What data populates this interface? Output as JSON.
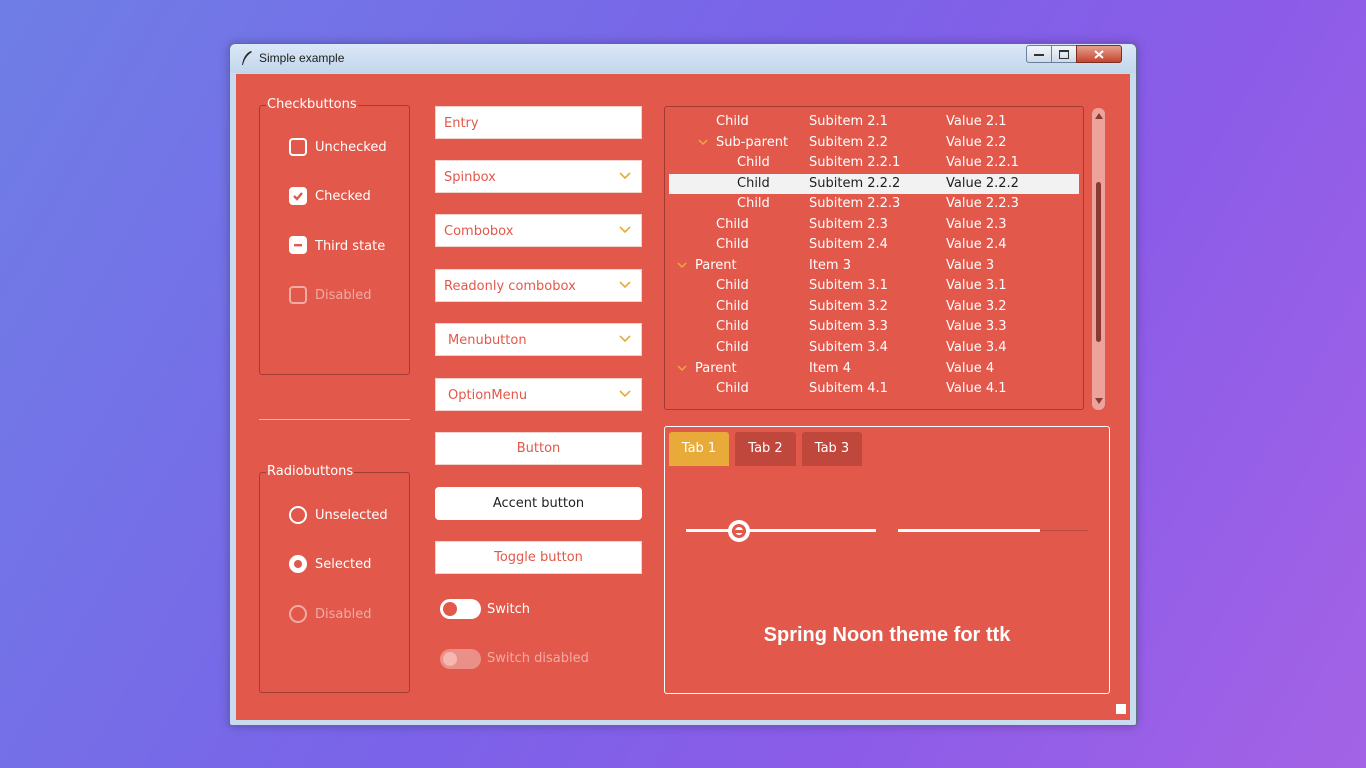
{
  "window": {
    "title": "Simple example",
    "accent_color": "#e2584b",
    "highlight_color": "#e8ab39"
  },
  "checkbuttons": {
    "label": "Checkbuttons",
    "items": [
      {
        "label": "Unchecked",
        "state": "unchecked"
      },
      {
        "label": "Checked",
        "state": "checked"
      },
      {
        "label": "Third state",
        "state": "indeterminate"
      },
      {
        "label": "Disabled",
        "state": "disabled"
      }
    ]
  },
  "radiobuttons": {
    "label": "Radiobuttons",
    "items": [
      {
        "label": "Unselected",
        "state": "unselected"
      },
      {
        "label": "Selected",
        "state": "selected"
      },
      {
        "label": "Disabled",
        "state": "disabled"
      }
    ]
  },
  "widgets": {
    "entry": "Entry",
    "spinbox": "Spinbox",
    "combobox": "Combobox",
    "readonly_combobox": "Readonly combobox",
    "menubutton": "Menubutton",
    "optionmenu": "OptionMenu",
    "button": "Button",
    "accent_button": "Accent button",
    "toggle_button": "Toggle button",
    "switch": "Switch",
    "switch_disabled": "Switch disabled"
  },
  "tree": {
    "rows": [
      {
        "name": "Child",
        "item": "Subitem 2.1",
        "value": "Value 2.1"
      },
      {
        "name": "Sub-parent",
        "item": "Subitem 2.2",
        "value": "Value 2.2"
      },
      {
        "name": "Child",
        "item": "Subitem 2.2.1",
        "value": "Value 2.2.1"
      },
      {
        "name": "Child",
        "item": "Subitem 2.2.2",
        "value": "Value 2.2.2"
      },
      {
        "name": "Child",
        "item": "Subitem 2.2.3",
        "value": "Value 2.2.3"
      },
      {
        "name": "Child",
        "item": "Subitem 2.3",
        "value": "Value 2.3"
      },
      {
        "name": "Child",
        "item": "Subitem 2.4",
        "value": "Value 2.4"
      },
      {
        "name": "Parent",
        "item": "Item 3",
        "value": "Value 3"
      },
      {
        "name": "Child",
        "item": "Subitem 3.1",
        "value": "Value 3.1"
      },
      {
        "name": "Child",
        "item": "Subitem 3.2",
        "value": "Value 3.2"
      },
      {
        "name": "Child",
        "item": "Subitem 3.3",
        "value": "Value 3.3"
      },
      {
        "name": "Child",
        "item": "Subitem 3.4",
        "value": "Value 3.4"
      },
      {
        "name": "Parent",
        "item": "Item 4",
        "value": "Value 4"
      },
      {
        "name": "Child",
        "item": "Subitem 4.1",
        "value": "Value 4.1"
      }
    ],
    "selected_index": 3
  },
  "notebook": {
    "tabs": [
      "Tab 1",
      "Tab 2",
      "Tab 3"
    ],
    "active_tab": 0,
    "scale_value": 0.3,
    "progress_value": 0.75,
    "caption": "Spring Noon theme for ttk"
  }
}
